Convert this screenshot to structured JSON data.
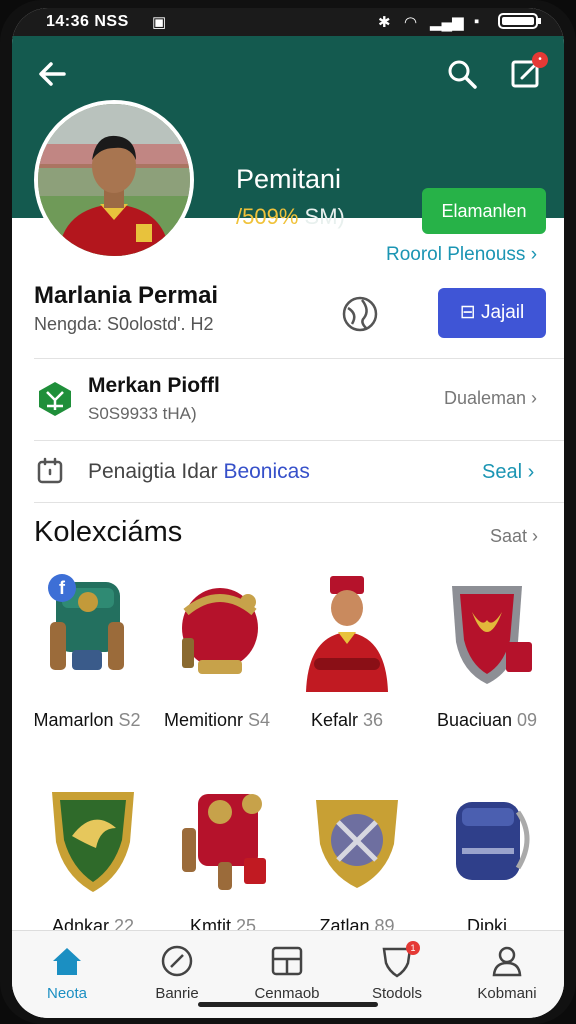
{
  "status": {
    "time": "14:36 NSS"
  },
  "header": {
    "name": "Pemitani",
    "stat_value": "/509%",
    "stat_rest": "SM)",
    "join_label": "Elamanlen"
  },
  "profile": {
    "link": "Roorol Plenouss",
    "name": "Marlania Permai",
    "subtitle": "Nengda: S0olostd'. H2",
    "button": "Jajail"
  },
  "rows": [
    {
      "title": "Merkan Pioffl",
      "subtitle": "S0S9933 tHA)",
      "right": "Dualeman"
    },
    {
      "text": "Penaigtia Idar",
      "accent": "Beonicas",
      "right": "Seal"
    }
  ],
  "collection": {
    "title": "Kolexciáms",
    "more": "Saat",
    "items": [
      {
        "name": "Mamarlon",
        "num": "S2",
        "icon": "backpack-icon"
      },
      {
        "name": "Memitionr",
        "num": "S4",
        "icon": "helmet-icon"
      },
      {
        "name": "Kefalr",
        "num": "36",
        "icon": "player-figure-icon"
      },
      {
        "name": "Buaciuan",
        "num": "09",
        "icon": "red-shield-icon"
      },
      {
        "name": "Adnkar",
        "num": "22",
        "icon": "green-shield-icon"
      },
      {
        "name": "Kmtit",
        "num": "25",
        "icon": "armor-pack-icon"
      },
      {
        "name": "Zatlan",
        "num": "89",
        "icon": "gold-shield-icon"
      },
      {
        "name": "Dipki",
        "num": "",
        "icon": "blue-bag-icon"
      }
    ]
  },
  "nav": [
    {
      "label": "Neota",
      "icon": "home-icon",
      "active": true
    },
    {
      "label": "Banrie",
      "icon": "gauge-icon"
    },
    {
      "label": "Cenmaob",
      "icon": "grid-box-icon"
    },
    {
      "label": "Stodols",
      "icon": "shield-badge-icon",
      "badge": "1"
    },
    {
      "label": "Kobmani",
      "icon": "person-icon"
    }
  ],
  "colors": {
    "header_bg": "#145a4f",
    "accent_green": "#27b248",
    "accent_blue": "#3f55d6",
    "link": "#1b95b3"
  }
}
